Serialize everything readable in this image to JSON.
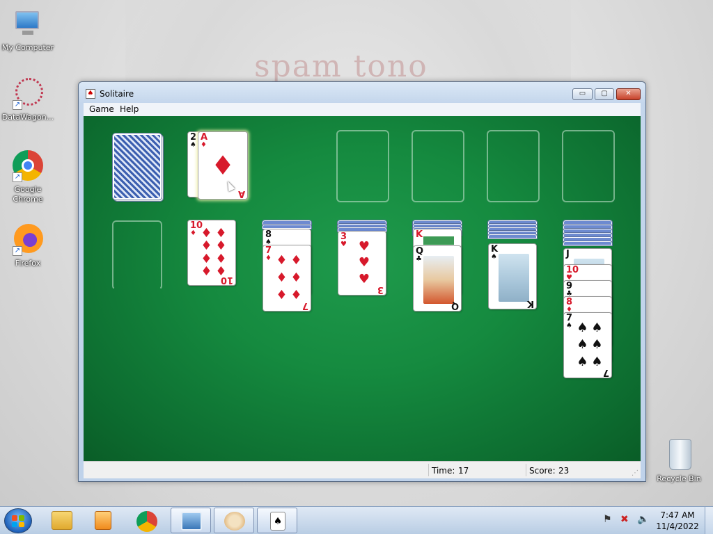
{
  "desktop": {
    "icons": [
      {
        "label": "My Computer"
      },
      {
        "label": "DataWagon..."
      },
      {
        "label": "Google Chrome"
      },
      {
        "label": "Firefox"
      },
      {
        "label": "Recycle Bin"
      }
    ],
    "wallpaper_text": "spam tono"
  },
  "window": {
    "title": "Solitaire",
    "menu": [
      "Game",
      "Help"
    ],
    "buttons": {
      "min": "▭",
      "max": "▢",
      "close": "✕"
    }
  },
  "game": {
    "stock": {
      "type": "card-back"
    },
    "waste": [
      {
        "rank": "2",
        "suit": "♠",
        "color": "black"
      },
      {
        "rank": "A",
        "suit": "♦",
        "color": "red"
      }
    ],
    "foundations": [
      {
        "empty": true
      },
      {
        "empty": true
      },
      {
        "empty": true
      },
      {
        "empty": true
      }
    ],
    "tableau": [
      {
        "hidden": 0,
        "faceup": []
      },
      {
        "hidden": 0,
        "faceup": [
          {
            "rank": "10",
            "suit": "♦",
            "color": "red"
          }
        ]
      },
      {
        "hidden": 2,
        "faceup": [
          {
            "rank": "8",
            "suit": "♠",
            "color": "black"
          },
          {
            "rank": "7",
            "suit": "♦",
            "color": "red"
          }
        ]
      },
      {
        "hidden": 3,
        "faceup": [
          {
            "rank": "3",
            "suit": "♥",
            "color": "red"
          }
        ]
      },
      {
        "hidden": 4,
        "faceup": [
          {
            "rank": "K",
            "suit": "♦",
            "color": "red"
          },
          {
            "rank": "Q",
            "suit": "♣",
            "color": "black"
          }
        ]
      },
      {
        "hidden": 5,
        "faceup": [
          {
            "rank": "K",
            "suit": "♠",
            "color": "black"
          }
        ]
      },
      {
        "hidden": 6,
        "faceup": [
          {
            "rank": "J",
            "suit": "♠",
            "color": "black"
          },
          {
            "rank": "10",
            "suit": "♥",
            "color": "red"
          },
          {
            "rank": "9",
            "suit": "♣",
            "color": "black"
          },
          {
            "rank": "8",
            "suit": "♦",
            "color": "red"
          },
          {
            "rank": "7",
            "suit": "♠",
            "color": "black"
          }
        ]
      }
    ]
  },
  "status": {
    "time_label": "Time:",
    "time_value": "17",
    "score_label": "Score:",
    "score_value": "23"
  },
  "taskbar": {
    "apps": [
      "start-button",
      "file-explorer",
      "media-player",
      "google-chrome",
      "photo-viewer",
      "paint",
      "solitaire"
    ],
    "clock_time": "7:47 AM",
    "clock_date": "11/4/2022"
  },
  "colors": {
    "felt": "#158a3f",
    "red_suit": "#d7192b",
    "black_suit": "#111111",
    "titlebar": "#c4d6ec"
  }
}
